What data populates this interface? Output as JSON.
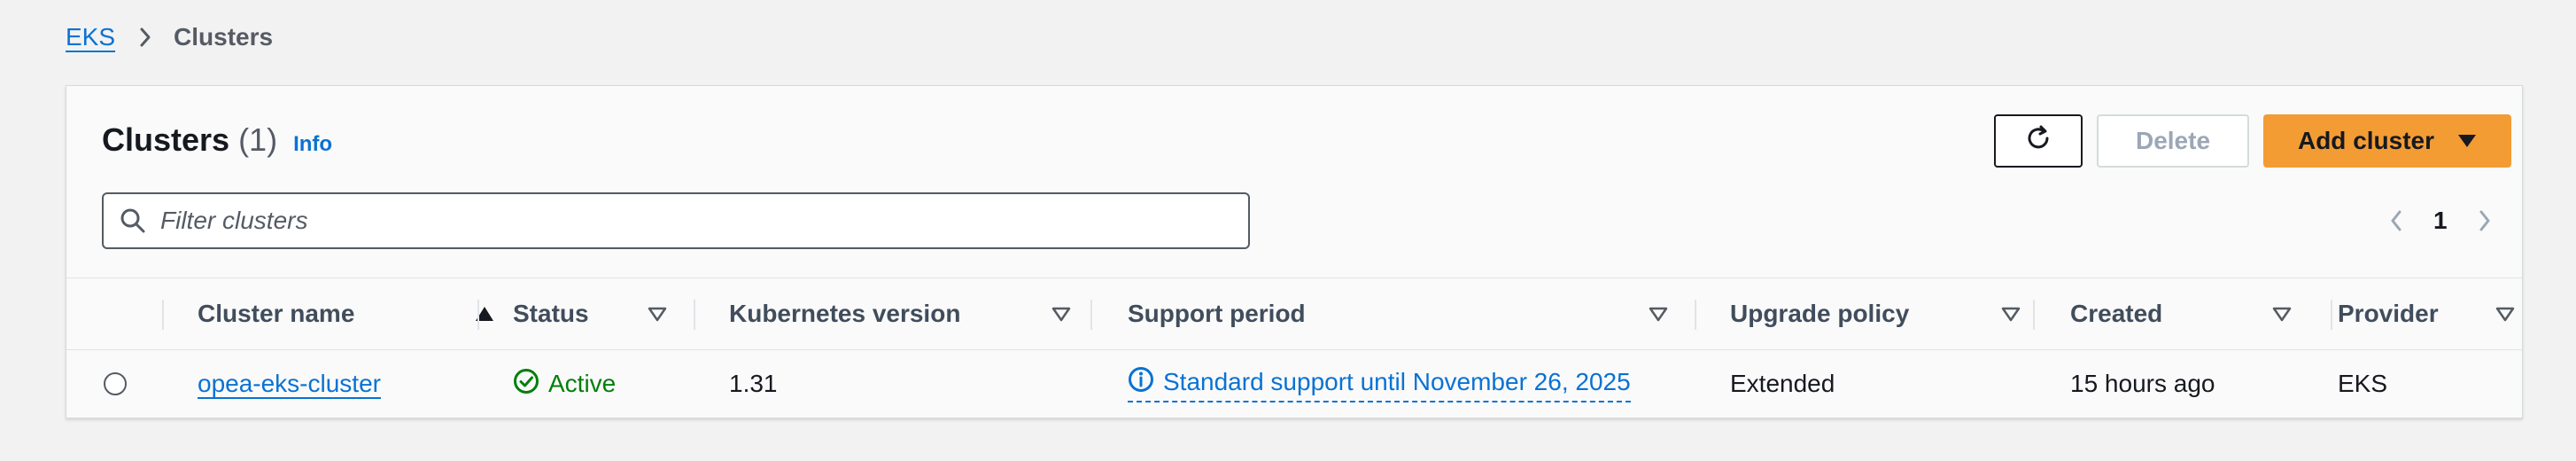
{
  "breadcrumb": {
    "root": "EKS",
    "current": "Clusters"
  },
  "header": {
    "title": "Clusters",
    "count": "(1)",
    "info_label": "Info"
  },
  "actions": {
    "delete_label": "Delete",
    "add_label": "Add cluster"
  },
  "filter": {
    "placeholder": "Filter clusters",
    "value": ""
  },
  "pagination": {
    "current_page": "1"
  },
  "table": {
    "columns": [
      "Cluster name",
      "Status",
      "Kubernetes version",
      "Support period",
      "Upgrade policy",
      "Created",
      "Provider"
    ],
    "sorted_column": "Cluster name",
    "sort_direction": "ascending",
    "rows": [
      {
        "cluster_name": "opea-eks-cluster",
        "status": "Active",
        "kubernetes_version": "1.31",
        "support_period": "Standard support until November 26, 2025",
        "upgrade_policy": "Extended",
        "created": "15 hours ago",
        "provider": "EKS"
      }
    ]
  },
  "colors": {
    "accent": "#0972d3",
    "primary_button": "#f39c34",
    "success": "#037f0c"
  },
  "icons": [
    "chevron-right-icon",
    "refresh-icon",
    "caret-down-icon",
    "search-icon",
    "chevron-left-icon",
    "sort-ascending-icon",
    "sort-icon",
    "check-circle-icon",
    "info-icon"
  ]
}
